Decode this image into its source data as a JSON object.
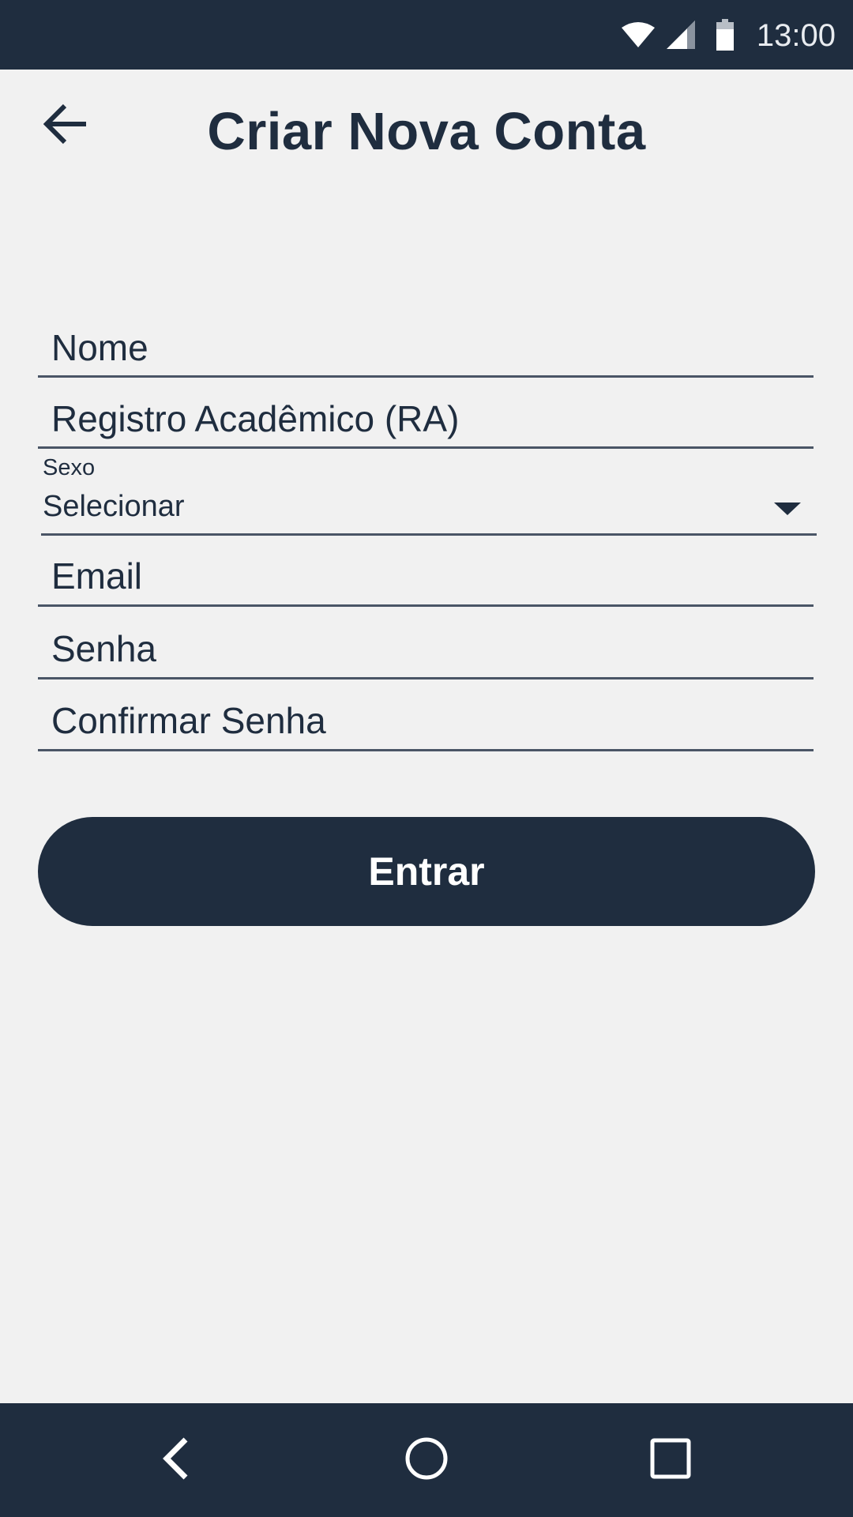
{
  "status_bar": {
    "time": "13:00",
    "icons": [
      "wifi-icon",
      "signal-icon",
      "battery-icon"
    ]
  },
  "header": {
    "title": "Criar Nova Conta",
    "back_icon": "arrow-left-icon"
  },
  "form": {
    "nome_placeholder": "Nome",
    "ra_placeholder": "Registro Acadêmico (RA)",
    "sexo": {
      "label": "Sexo",
      "selected": "Selecionar"
    },
    "email_placeholder": "Email",
    "senha_placeholder": "Senha",
    "confirmar_senha_placeholder": "Confirmar Senha",
    "submit_label": "Entrar"
  },
  "nav_bar": {
    "icons": [
      "nav-back-icon",
      "nav-home-icon",
      "nav-recents-icon"
    ]
  },
  "colors": {
    "primary": "#1f2d3f",
    "background": "#f1f1f1",
    "underline": "#4a5566",
    "button_text": "#ffffff"
  }
}
